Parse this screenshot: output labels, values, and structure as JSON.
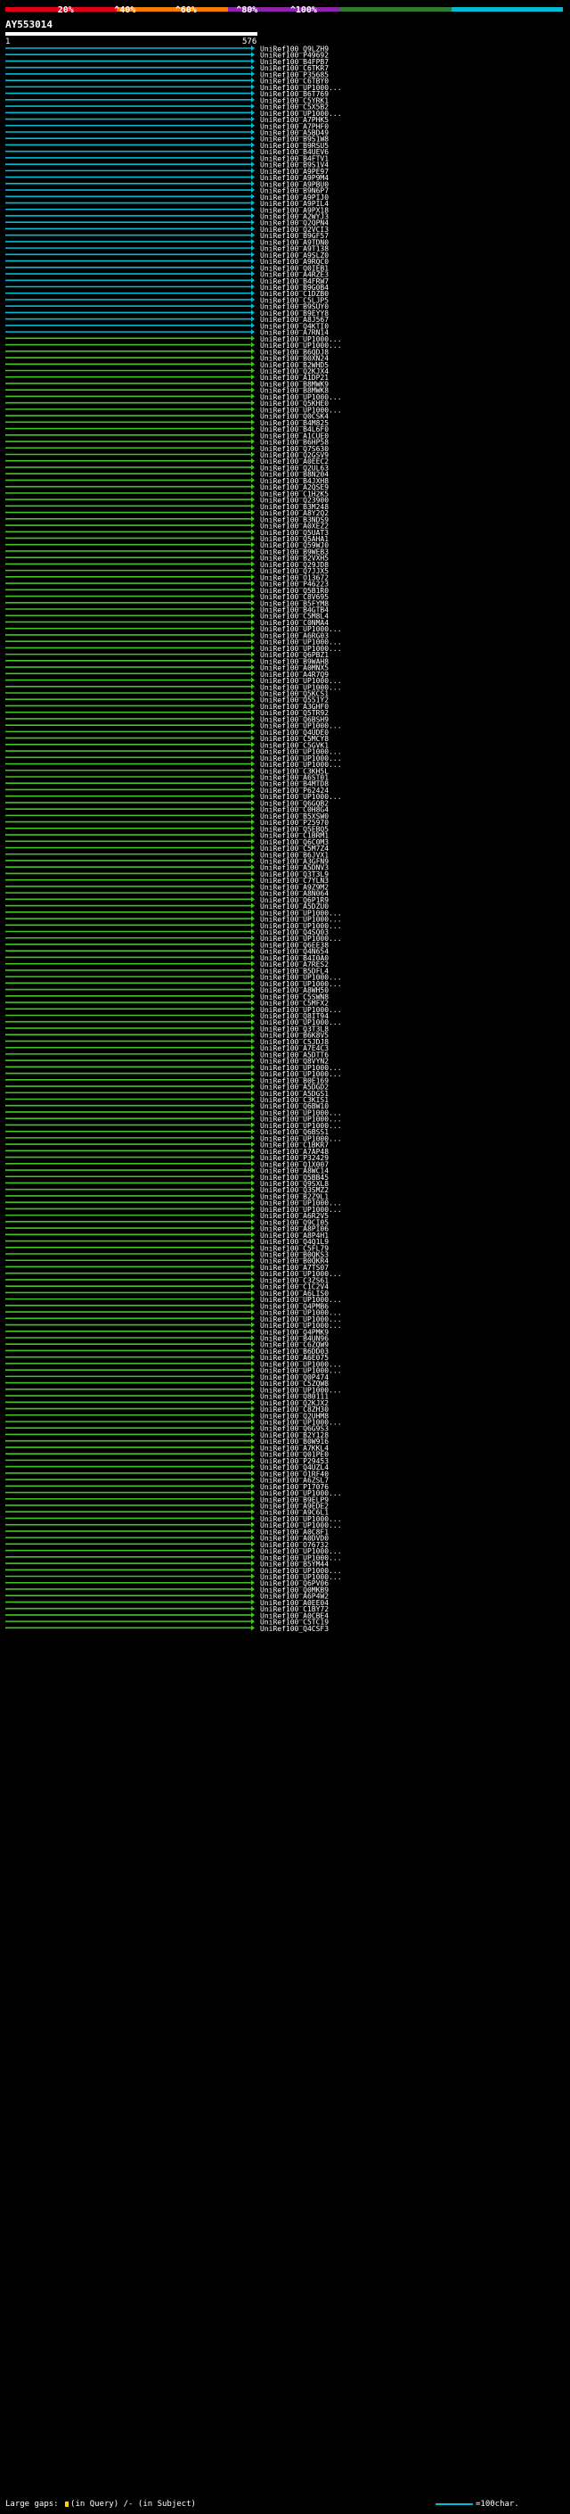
{
  "legend": {
    "colors": [
      "#e3001b",
      "#f57c00",
      "#8e24aa",
      "#2e7d32",
      "#00bcd4"
    ],
    "labels": [
      "20%",
      "^40%",
      "^60%",
      "^80%",
      "^100%"
    ]
  },
  "query": {
    "id": "AY553014",
    "start": "1",
    "end": "576"
  },
  "hits": [
    "UniRef100_Q9LZH9",
    "UniRef100_P49692",
    "UniRef100_B4FPB7",
    "UniRef100_C6TKR7",
    "UniRef100_P35685",
    "UniRef100_C6TBY0",
    "UniRef100_UP1000...",
    "UniRef100_B6T769",
    "UniRef100_C5YRK1",
    "UniRef100_C5X5B2",
    "UniRef100_UP1000...",
    "UniRef100_A7PHK5",
    "UniRef100_A7PHF0",
    "UniRef100_A5BD49",
    "UniRef100_B9S1W8",
    "UniRef100_B9RSU5",
    "UniRef100_B4UEV6",
    "UniRef100_B4FTV1",
    "UniRef100_B9S1V4",
    "UniRef100_A9PE97",
    "UniRef100_A9P9M4",
    "UniRef100_A9PBU0",
    "UniRef100_B9N6P7",
    "UniRef100_A9PIJ0",
    "UniRef100_A9PIL4",
    "UniRef100_A9PX18",
    "UniRef100_A2WYJ3",
    "UniRef100_Q2QPN4",
    "UniRef100_Q2VCI3",
    "UniRef100_B9GF57",
    "UniRef100_A9TDN0",
    "UniRef100_A9T138",
    "UniRef100_A9SLZ0",
    "UniRef100_A9RQC0",
    "UniRef100_Q0IEB1",
    "UniRef100_A4RZE3",
    "UniRef100_B4FRW7",
    "UniRef100_B9G0B4",
    "UniRef100_C1DZB0",
    "UniRef100_C5LJP5",
    "UniRef100_B9SUY0",
    "UniRef100_B9EYY8",
    "UniRef100_A8J567",
    "UniRef100_Q4KTI0",
    "UniRef100_A7RN14",
    "UniRef100_UP1000...",
    "UniRef100_UP1000...",
    "UniRef100_B6QDJ8",
    "UniRef100_B0XN24",
    "UniRef100_B2WHD5",
    "UniRef100_Q2KJX4",
    "UniRef100_A1DP21",
    "UniRef100_B8MWK9",
    "UniRef100_B8MWK8",
    "UniRef100_UP1000...",
    "UniRef100_Q5KHE0",
    "UniRef100_UP1000...",
    "UniRef100_Q0CSK4",
    "UniRef100_B4M825",
    "UniRef100_B4L6F0",
    "UniRef100_A1CUE0",
    "UniRef100_B6HP58",
    "UniRef100_Q7S630",
    "UniRef100_Q2GSV9",
    "UniRef100_A0EEC2",
    "UniRef100_Q2UL63",
    "UniRef100_B8N204",
    "UniRef100_B4JXH8",
    "UniRef100_A2QSE9",
    "UniRef100_C1H2K5",
    "UniRef100_Q23900",
    "UniRef100_B3M248",
    "UniRef100_A8Y2Q2",
    "UniRef100_B3NDS9",
    "UniRef100_A0XEZ2",
    "UniRef100_Q5UAT3",
    "UniRef100_Q5AHA1",
    "UniRef100_Q59WJ0",
    "UniRef100_B9WEB3",
    "UniRef100_B2VXH5",
    "UniRef100_Q29JD8",
    "UniRef100_Q7JJX5",
    "UniRef100_O13672",
    "UniRef100_P46223",
    "UniRef100_Q5B1R0",
    "UniRef100_C8V695",
    "UniRef100_B5FYM8",
    "UniRef100_B4GTB4",
    "UniRef100_C5M8L4",
    "UniRef100_C0NMA4",
    "UniRef100_UP1000...",
    "UniRef100_A6RG03",
    "UniRef100_UP1000...",
    "UniRef100_UP1000...",
    "UniRef100_Q6PBZ1",
    "UniRef100_B9WAH8",
    "UniRef100_A0MNX5",
    "UniRef100_A4R7Q9",
    "UniRef100_UP1000...",
    "UniRef100_UP1000...",
    "UniRef100_Q5KCS1",
    "UniRef100_Q551Y2",
    "UniRef100_A3GHF0",
    "UniRef100_Q5TR92",
    "UniRef100_Q6BSH9",
    "UniRef100_UP1000...",
    "UniRef100_Q4UDE0",
    "UniRef100_C5MCY8",
    "UniRef100_C5GVK1",
    "UniRef100_UP1000...",
    "UniRef100_UP1000...",
    "UniRef100_UP1000...",
    "UniRef100_C3KH5L",
    "UniRef100_A6ST01",
    "UniRef100_B4MTD8",
    "UniRef100_P62424",
    "UniRef100_UP1000...",
    "UniRef100_Q6GQB2",
    "UniRef100_C0H8G4",
    "UniRef100_B5XSW0",
    "UniRef100_P25970",
    "UniRef100_Q5EBQ5",
    "UniRef100_C1BRM1",
    "UniRef100_Q6C0M3",
    "UniRef100_C5M7Z4",
    "UniRef100_B6JVX1",
    "UniRef100_A3GFN9",
    "UniRef100_A5DNV3",
    "UniRef100_Q3T3L9",
    "UniRef100_C7YLN3",
    "UniRef100_A9Z9M2",
    "UniRef100_A8N064",
    "UniRef100_Q6P1R9",
    "UniRef100_A5DZU0",
    "UniRef100_UP1000...",
    "UniRef100_UP1000...",
    "UniRef100_UP1000...",
    "UniRef100_Q4SQ03",
    "UniRef100_UP1000...",
    "UniRef100_Q6EE38",
    "UniRef100_Q4N654",
    "UniRef100_B4I0A0",
    "UniRef100_A7RES2",
    "UniRef100_B5DFL4",
    "UniRef100_UP1000...",
    "UniRef100_UP1000...",
    "UniRef100_A8WH50",
    "UniRef100_C5SWN8",
    "UniRef100_C5MFX2",
    "UniRef100_UP1000...",
    "UniRef100_Q8IT94",
    "UniRef100_UP1000...",
    "UniRef100_Q3T3L8",
    "UniRef100_B6K8V5",
    "UniRef100_C5JDJ8",
    "UniRef100_A7E4C3",
    "UniRef100_A5DTT6",
    "UniRef100_Q8VYN2",
    "UniRef100_UP1000...",
    "UniRef100_UP1000...",
    "UniRef100_B0E169",
    "UniRef100_A5DGD2",
    "UniRef100_A5DGS1",
    "UniRef100_C3KIS1",
    "UniRef100_Q6BW10",
    "UniRef100_UP1000...",
    "UniRef100_UP1000...",
    "UniRef100_UP1000...",
    "UniRef100_Q6BSS1",
    "UniRef100_UP1000...",
    "UniRef100_C1BKR7",
    "UniRef100_A7AP48",
    "UniRef100_P32429",
    "UniRef100_Q1X007",
    "UniRef100_A8WC14",
    "UniRef100_Q5BB45",
    "UniRef100_Q9SXL8",
    "UniRef100_Q3SMZ2",
    "UniRef100_B2Z9L1",
    "UniRef100_UP1000...",
    "UniRef100_UP1000...",
    "UniRef100_A6R2V5",
    "UniRef100_Q9CI05",
    "UniRef100_A8PI06",
    "UniRef100_A8P4H1",
    "UniRef100_Q4Q1L9",
    "UniRef100_C5FL79",
    "UniRef100_B0QKS3",
    "UniRef100_B0QKR4",
    "UniRef100_A7TS07",
    "UniRef100_UP1000...",
    "UniRef100_C3ZS61",
    "UniRef100_C1C2V4",
    "UniRef100_A6LIS0",
    "UniRef100_UP1000...",
    "UniRef100_Q4PMB6",
    "UniRef100_UP1000...",
    "UniRef100_UP1000...",
    "UniRef100_UP1000...",
    "UniRef100_Q4PMK9",
    "UniRef100_B4UN96",
    "UniRef100_C6ZQW9",
    "UniRef100_B6DD03",
    "UniRef100_A6E075",
    "UniRef100_UP1000...",
    "UniRef100_UP1000...",
    "UniRef100_Q0P474",
    "UniRef100_C5ZQW8",
    "UniRef100_UP1000...",
    "UniRef100_Q80111",
    "UniRef100_Q2KJX2",
    "UniRef100_C8ZH30",
    "UniRef100_Q2UHM8",
    "UniRef100_UP1000...",
    "UniRef100_Q6G9S3",
    "UniRef100_B2Y128",
    "UniRef100_B0W916",
    "UniRef100_A7KKL4",
    "UniRef100_Q01PE0",
    "UniRef100_P29453",
    "UniRef100_Q4UZL4",
    "UniRef100_O1RF40",
    "UniRef100_A6ZSL7",
    "UniRef100_P17076",
    "UniRef100_UP1000...",
    "UniRef100_B9ELP9",
    "UniRef100_A9EDE2",
    "UniRef100_A9C6L1",
    "UniRef100_UP1000...",
    "UniRef100_UP1000...",
    "UniRef100_A0C8F1",
    "UniRef100_A0DVD0",
    "UniRef100_O76732",
    "UniRef100_UP1000...",
    "UniRef100_UP1000...",
    "UniRef100_B5YM44",
    "UniRef100_UP1000...",
    "UniRef100_UP1000...",
    "UniRef100_Q6PV06",
    "UniRef100_Q0MKB9",
    "UniRef100_A6P4W2",
    "UniRef100_A0EE04",
    "UniRef100_C1BY72",
    "UniRef100_A0CBE4",
    "UniRef100_C5TC19",
    "UniRef100_Q4CSF3"
  ],
  "footer": {
    "large_gaps_label": "Large gaps:",
    "in_query": "(in Query)",
    "in_subject": "/- (in Subject)",
    "scale_label": "=100char."
  }
}
